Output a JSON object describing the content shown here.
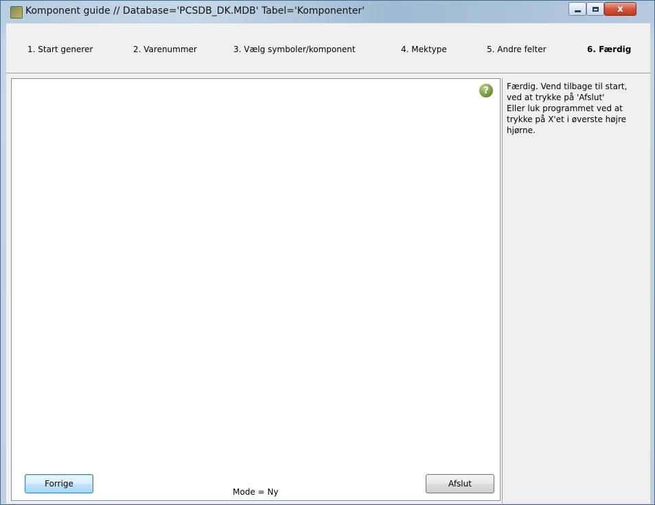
{
  "window": {
    "title": "Komponent guide  //  Database='PCSDB_DK.MDB' Tabel='Komponenter'",
    "close_glyph": "x"
  },
  "tabs": [
    {
      "label": "1. Start generer",
      "active": false
    },
    {
      "label": "2. Varenummer",
      "active": false
    },
    {
      "label": "3. Vælg symboler/komponent",
      "active": false
    },
    {
      "label": "4. Mektype",
      "active": false
    },
    {
      "label": "5. Andre felter",
      "active": false
    },
    {
      "label": "6. Færdig",
      "active": true
    }
  ],
  "help": {
    "lines": [
      "Færdig. Vend tilbage til start,",
      "ved at trykke på 'Afslut'",
      "Eller luk programmet ved at",
      "trykke på X'et i øverste højre",
      "hjørne."
    ],
    "icon_glyph": "?"
  },
  "footer": {
    "prev_label": "Forrige",
    "exit_label": "Afslut",
    "mode_text": "Mode = Ny"
  },
  "colors": {
    "titlebar": "#b8cde0",
    "close_button": "#d2573f",
    "help_icon": "#6c8c35",
    "focused_button": "#bee6fd"
  }
}
